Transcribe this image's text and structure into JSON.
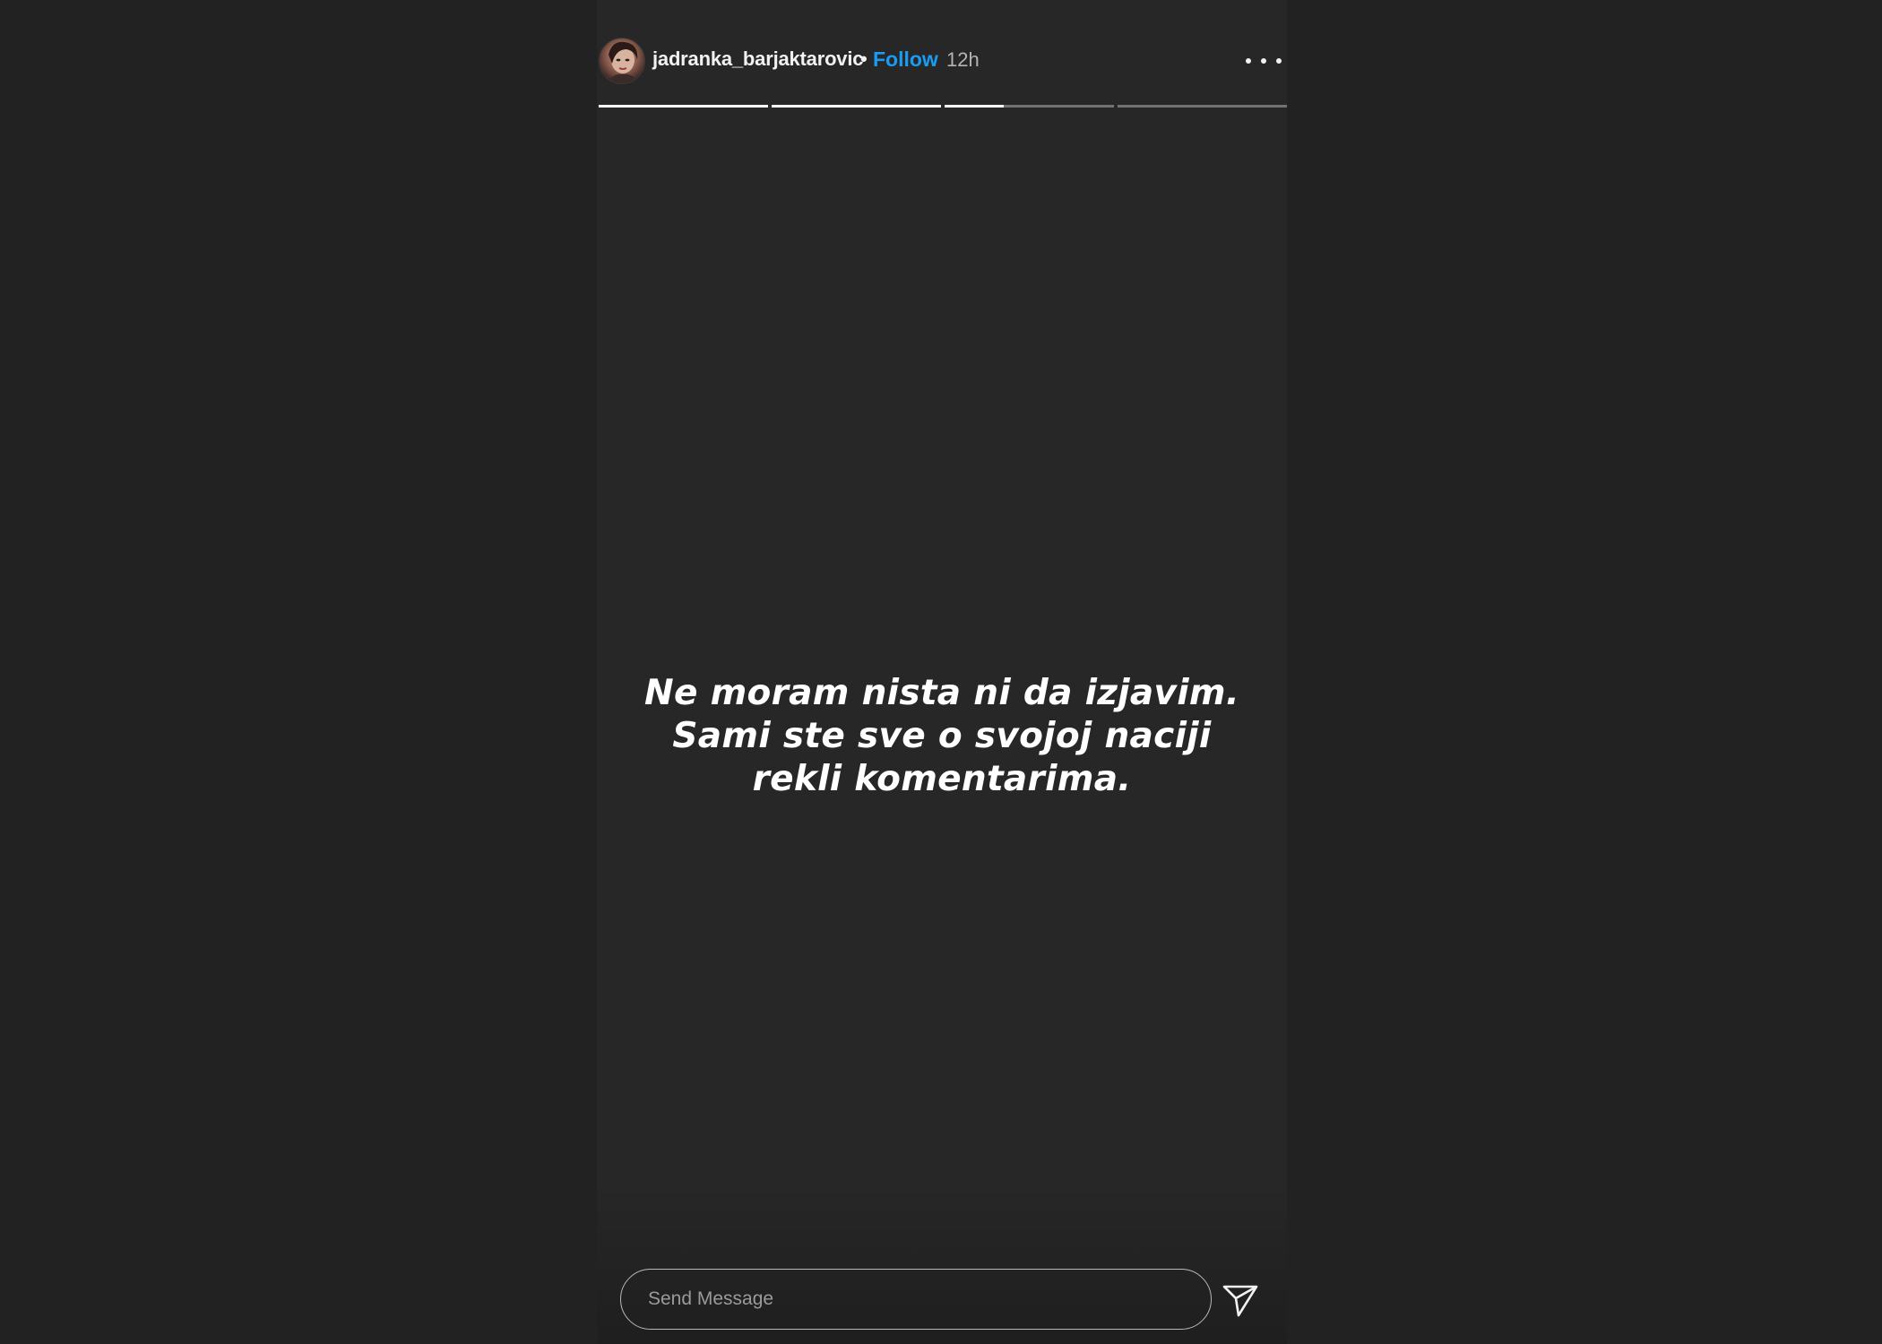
{
  "story": {
    "username": "jadranka_barjaktarovic",
    "separator": "•",
    "follow_label": "Follow",
    "time": "12h",
    "progress": [
      {
        "fill": 1.0
      },
      {
        "fill": 1.0
      },
      {
        "fill": 0.35
      },
      {
        "fill": 0.0
      }
    ],
    "caption": "Ne moram nista ni da izjavim. Sami ste sve o svojoj naciji rekli komentarima."
  },
  "reply": {
    "placeholder": "Send Message"
  },
  "icons": {
    "avatar": "profile-avatar",
    "more": "more-options-icon",
    "send": "paper-plane-icon"
  },
  "colors": {
    "background": "#222222",
    "story_background": "#272727",
    "follow": "#1a9cf2",
    "text": "#f2f2f2"
  }
}
